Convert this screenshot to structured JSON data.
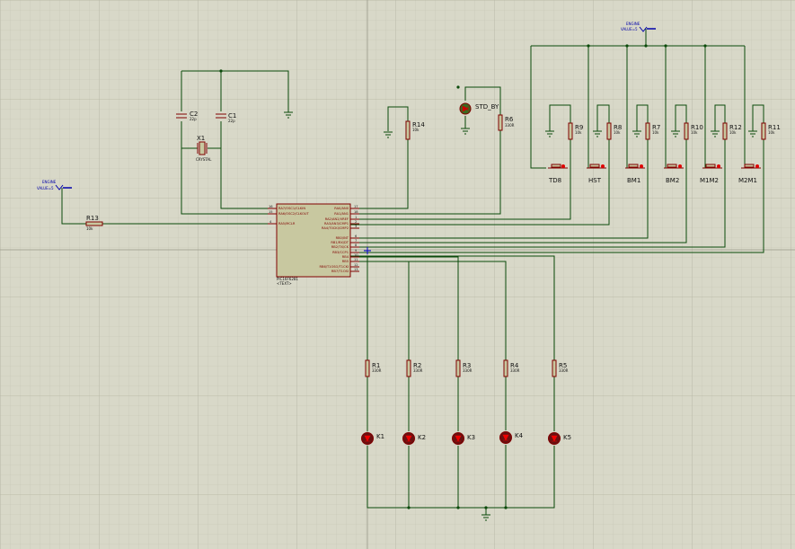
{
  "mcu": {
    "name": "PIC16F6281",
    "text": "<TEXT>",
    "left_pins": [
      {
        "no": "16",
        "name": "RA7/OSC1/CLKIN"
      },
      {
        "no": "15",
        "name": "RA6/OSC2/CLKOUT"
      },
      {
        "no": "4",
        "name": "RA5/MCLR"
      }
    ],
    "right_pins": [
      {
        "no": "17",
        "name": "RA0/AN0"
      },
      {
        "no": "18",
        "name": "RA1/AN1"
      },
      {
        "no": "1",
        "name": "RA2/AN2/VREF"
      },
      {
        "no": "2",
        "name": "RA3/AN3/CMP1"
      },
      {
        "no": "3",
        "name": "RA4/T0CKI/CMP2"
      },
      {
        "no": "6",
        "name": "RB0/INT"
      },
      {
        "no": "7",
        "name": "RB1/RX/DT"
      },
      {
        "no": "8",
        "name": "RB2/TX/CK"
      },
      {
        "no": "9",
        "name": "RB3/CCP1"
      },
      {
        "no": "10",
        "name": "RB4"
      },
      {
        "no": "11",
        "name": "RB5"
      },
      {
        "no": "12",
        "name": "RB6/T1OSO/T1CKI"
      },
      {
        "no": "13",
        "name": "RB7/T1OSI"
      }
    ]
  },
  "crystal": {
    "name": "X1",
    "type": "CRYSTAL"
  },
  "capacitors": [
    {
      "name": "C2",
      "value": "22p"
    },
    {
      "name": "C1",
      "value": "22p"
    }
  ],
  "resistors": {
    "R13": {
      "name": "R13",
      "value": "10k"
    },
    "R14": {
      "name": "R14",
      "value": "10k"
    },
    "R6": {
      "name": "R6",
      "value": "330R"
    },
    "switch_pullups": [
      {
        "name": "R9",
        "value": "10k"
      },
      {
        "name": "R8",
        "value": "10k"
      },
      {
        "name": "R7",
        "value": "10k"
      },
      {
        "name": "R10",
        "value": "10k"
      },
      {
        "name": "R12",
        "value": "10k"
      },
      {
        "name": "R11",
        "value": "10k"
      }
    ],
    "led_series": [
      {
        "name": "R1",
        "value": "330R"
      },
      {
        "name": "R2",
        "value": "330R"
      },
      {
        "name": "R3",
        "value": "330R"
      },
      {
        "name": "R4",
        "value": "330R"
      },
      {
        "name": "R5",
        "value": "330R"
      }
    ]
  },
  "switches": [
    "TD8",
    "HST",
    "BM1",
    "BM2",
    "M1M2",
    "M2M1"
  ],
  "leds": [
    "K1",
    "K2",
    "K3",
    "K4",
    "K5"
  ],
  "standby_led": "STD_BY",
  "power_terminals": [
    {
      "label": "VALUE=5",
      "name": "ENGINE"
    },
    {
      "label": "VALUE=5",
      "name": "ENGINE"
    }
  ]
}
